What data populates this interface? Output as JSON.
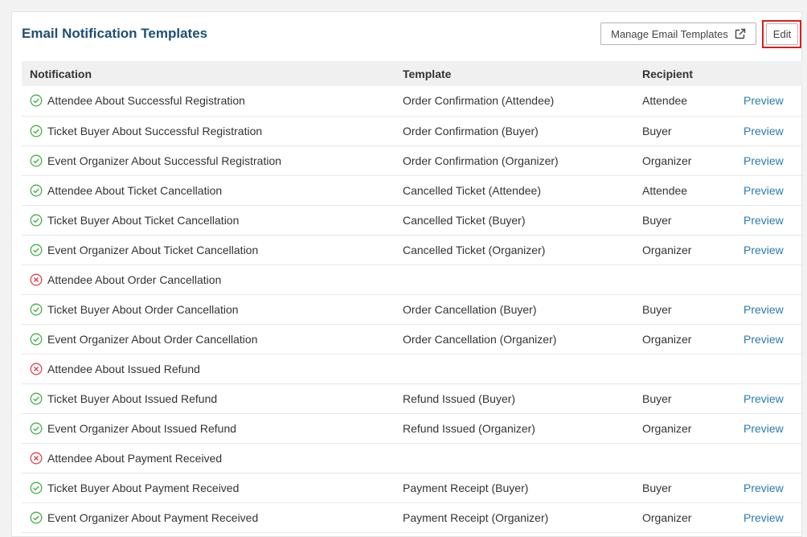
{
  "header": {
    "title": "Email Notification Templates",
    "manage_label": "Manage Email Templates",
    "manage_icon": "external-link-icon",
    "edit_label": "Edit"
  },
  "table": {
    "columns": [
      "Notification",
      "Template",
      "Recipient",
      ""
    ],
    "rows": [
      {
        "status": "enabled",
        "notification": "Attendee About Successful Registration",
        "template": "Order Confirmation (Attendee)",
        "recipient": "Attendee",
        "preview": "Preview"
      },
      {
        "status": "enabled",
        "notification": "Ticket Buyer About Successful Registration",
        "template": "Order Confirmation (Buyer)",
        "recipient": "Buyer",
        "preview": "Preview"
      },
      {
        "status": "enabled",
        "notification": "Event Organizer About Successful Registration",
        "template": "Order Confirmation (Organizer)",
        "recipient": "Organizer",
        "preview": "Preview"
      },
      {
        "status": "enabled",
        "notification": "Attendee About Ticket Cancellation",
        "template": "Cancelled Ticket (Attendee)",
        "recipient": "Attendee",
        "preview": "Preview"
      },
      {
        "status": "enabled",
        "notification": "Ticket Buyer About Ticket Cancellation",
        "template": "Cancelled Ticket (Buyer)",
        "recipient": "Buyer",
        "preview": "Preview"
      },
      {
        "status": "enabled",
        "notification": "Event Organizer About Ticket Cancellation",
        "template": "Cancelled Ticket (Organizer)",
        "recipient": "Organizer",
        "preview": "Preview"
      },
      {
        "status": "disabled",
        "notification": "Attendee About Order Cancellation",
        "template": "",
        "recipient": "",
        "preview": ""
      },
      {
        "status": "enabled",
        "notification": "Ticket Buyer About Order Cancellation",
        "template": "Order Cancellation (Buyer)",
        "recipient": "Buyer",
        "preview": "Preview"
      },
      {
        "status": "enabled",
        "notification": "Event Organizer About Order Cancellation",
        "template": "Order Cancellation (Organizer)",
        "recipient": "Organizer",
        "preview": "Preview"
      },
      {
        "status": "disabled",
        "notification": "Attendee About Issued Refund",
        "template": "",
        "recipient": "",
        "preview": ""
      },
      {
        "status": "enabled",
        "notification": "Ticket Buyer About Issued Refund",
        "template": "Refund Issued (Buyer)",
        "recipient": "Buyer",
        "preview": "Preview"
      },
      {
        "status": "enabled",
        "notification": "Event Organizer About Issued Refund",
        "template": "Refund Issued (Organizer)",
        "recipient": "Organizer",
        "preview": "Preview"
      },
      {
        "status": "disabled",
        "notification": "Attendee About Payment Received",
        "template": "",
        "recipient": "",
        "preview": ""
      },
      {
        "status": "enabled",
        "notification": "Ticket Buyer About Payment Received",
        "template": "Payment Receipt (Buyer)",
        "recipient": "Buyer",
        "preview": "Preview"
      },
      {
        "status": "enabled",
        "notification": "Event Organizer About Payment Received",
        "template": "Payment Receipt (Organizer)",
        "recipient": "Organizer",
        "preview": "Preview"
      }
    ]
  },
  "colors": {
    "title": "#1f4f73",
    "enabled": "#45b045",
    "disabled": "#e0434e",
    "link": "#2a7ab0",
    "highlight": "#e01b1b"
  }
}
